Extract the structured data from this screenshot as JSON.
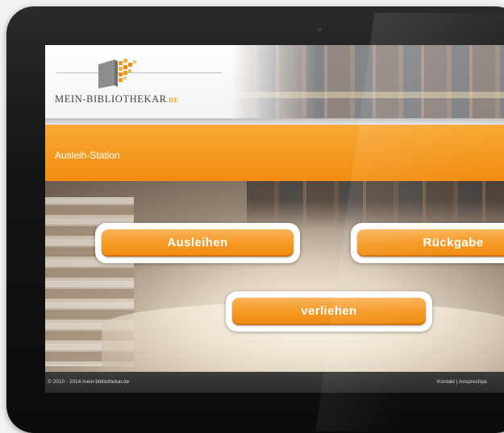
{
  "header": {
    "logo_main": "MEIN-BIBLIOTHEKAR",
    "logo_suffix": ".DE"
  },
  "station": {
    "title": "Ausleih-Station"
  },
  "actions": {
    "lend_label": "Ausleihen",
    "return_label": "Rückgabe",
    "lent_label": "verliehen"
  },
  "footer": {
    "copyright": "© 2010 - 2014 mein-bibliothekar.de",
    "contact_label": "Kontakt",
    "separator": "|",
    "contact_person_label": "Ansprechpa"
  },
  "colors": {
    "accent": "#f28c10",
    "footer": "#2f2f2f"
  }
}
